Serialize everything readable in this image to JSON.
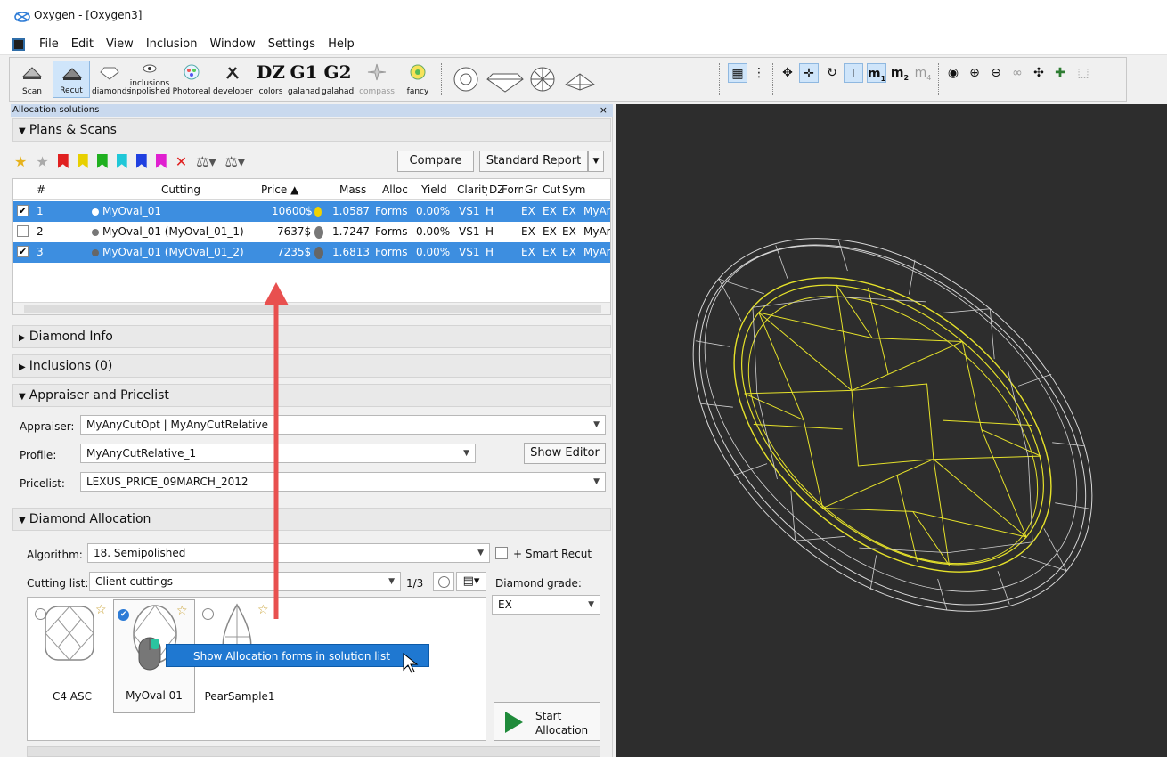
{
  "window": {
    "title": "Oxygen - [Oxygen3]"
  },
  "menu": [
    "File",
    "Edit",
    "View",
    "Inclusion",
    "Window",
    "Settings",
    "Help"
  ],
  "toolbar": {
    "buttons": [
      {
        "label": "Scan",
        "icon": "scan-icon"
      },
      {
        "label": "Recut",
        "icon": "recut-icon"
      },
      {
        "label": "diamonds",
        "icon": "diamonds-icon"
      },
      {
        "label": "inclusions",
        "label2": "inpolished",
        "icon": "inclusions-icon"
      },
      {
        "label": "Photoreal",
        "icon": "photoreal-icon"
      },
      {
        "label": "developer",
        "icon": "developer-icon"
      },
      {
        "label": "colors",
        "glyph": "DZ"
      },
      {
        "label": "galahad",
        "glyph": "G1"
      },
      {
        "label": "galahad",
        "glyph": "G2"
      },
      {
        "label": "compass",
        "icon": "compass-icon"
      },
      {
        "label": "fancy",
        "icon": "fancy-icon"
      }
    ],
    "m_labels": [
      "m",
      "m",
      "m"
    ],
    "m_subs": [
      "1",
      "2",
      "4"
    ]
  },
  "panel": {
    "title": "Allocation solutions",
    "close": "×"
  },
  "plans": {
    "section": "Plans & Scans",
    "compare": "Compare",
    "standard_report": "Standard Report",
    "columns": [
      "#",
      "Cutting",
      "Price ▲",
      "Mass",
      "Alloc",
      "Yield",
      "Clarity",
      "DZ",
      "Form",
      "Gr",
      "Cut",
      "Sym"
    ],
    "rows": [
      {
        "num": "1",
        "checked": true,
        "selected": true,
        "cutting": "MyOval_01",
        "price": "10600$",
        "mass": "1.0587",
        "alloc": "Forms",
        "yield": "0.00%",
        "clarity": "VS1",
        "color": "H",
        "gr": "EX",
        "cut": "EX",
        "sym": "EX",
        "extra": "MyAr"
      },
      {
        "num": "2",
        "checked": false,
        "selected": false,
        "cutting": "MyOval_01 (MyOval_01_1)",
        "price": "7637$",
        "mass": "1.7247",
        "alloc": "Forms",
        "yield": "0.00%",
        "clarity": "VS1",
        "color": "H",
        "gr": "EX",
        "cut": "EX",
        "sym": "EX",
        "extra": "MyAr"
      },
      {
        "num": "3",
        "checked": true,
        "selected": true,
        "cutting": "MyOval_01 (MyOval_01_2)",
        "price": "7235$",
        "mass": "1.6813",
        "alloc": "Forms",
        "yield": "0.00%",
        "clarity": "VS1",
        "color": "H",
        "gr": "EX",
        "cut": "EX",
        "sym": "EX",
        "extra": "MyAr"
      }
    ]
  },
  "diamond_info": {
    "section": "Diamond Info"
  },
  "inclusions": {
    "section": "Inclusions (0)"
  },
  "appraiser": {
    "section": "Appraiser and Pricelist",
    "appraiser_label": "Appraiser:",
    "appraiser_value": "MyAnyCutOpt | MyAnyCutRelative",
    "profile_label": "Profile:",
    "profile_value": "MyAnyCutRelative_1",
    "show_editor": "Show Editor",
    "pricelist_label": "Pricelist:",
    "pricelist_value": "LEXUS_PRICE_09MARCH_2012"
  },
  "allocation": {
    "section": "Diamond Allocation",
    "algorithm_label": "Algorithm:",
    "algorithm_value": "18. Semipolished",
    "smart_recut": "+ Smart Recut",
    "cutting_list_label": "Cutting list:",
    "cutting_list_value": "Client cuttings",
    "page": "1/3",
    "grade_label": "Diamond grade:",
    "grade_value": "EX",
    "cards": [
      {
        "name": "C4 ASC",
        "selected": false
      },
      {
        "name": "MyOval 01",
        "selected": true
      },
      {
        "name": "PearSample1",
        "selected": false
      }
    ],
    "start": "Start",
    "start2": "Allocation"
  },
  "tooltip": {
    "text": "Show Allocation forms in solution list"
  },
  "colors": {
    "selection": "#3d8ee0",
    "arrow": "#e8504f",
    "wire_yellow": "#e6e22a",
    "wire_white": "#d8d8d8",
    "viewport_bg": "#2d2d2d"
  }
}
